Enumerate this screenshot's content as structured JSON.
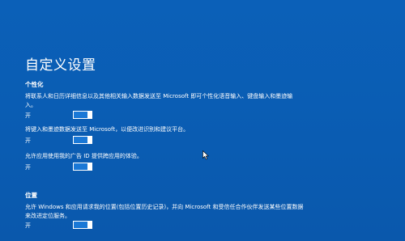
{
  "page": {
    "title": "自定义设置"
  },
  "sections": [
    {
      "heading": "个性化",
      "items": [
        {
          "description": "将联系人和日历详细信息以及其他相关输入数据发送至 Microsoft 即可个性化语音输入、键盘输入和墨迹输入。",
          "toggle_label": "开",
          "state": "on"
        },
        {
          "description": "将键入和墨迹数据发送至 Microsoft，以便改进识别和建议平台。",
          "toggle_label": "开",
          "state": "on"
        },
        {
          "description": "允许应用使用我的广告 ID 提供跨应用的体验。",
          "toggle_label": "开",
          "state": "on"
        }
      ]
    },
    {
      "heading": "位置",
      "items": [
        {
          "description": "允许 Windows 和应用请求我的位置(包括位置历史记录)，并向 Microsoft 和受信任合作伙伴发送某些位置数据来改进定位服务。",
          "toggle_label": "开",
          "state": "on"
        }
      ]
    }
  ],
  "colors": {
    "background": "#0b5fb6",
    "text": "#ffffff",
    "toggle_fill": "#1a78d6"
  },
  "icons": {
    "cursor": "mouse-pointer-icon"
  }
}
